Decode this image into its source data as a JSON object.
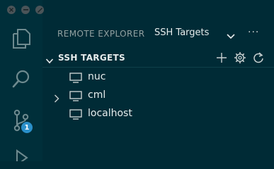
{
  "window": {
    "controls": [
      "close-icon",
      "minimize-icon",
      "fullscreen-icon"
    ]
  },
  "activity_bar": {
    "items": [
      {
        "icon": "files-icon"
      },
      {
        "icon": "search-icon"
      },
      {
        "icon": "source-control-icon",
        "badge": "1"
      },
      {
        "icon": "run-debug-icon"
      }
    ],
    "badge_color": "#2a8fc9"
  },
  "sidebar": {
    "title": "REMOTE EXPLORER",
    "selected_view": "SSH Targets",
    "more_label": "···",
    "section": {
      "title": "SSH TARGETS",
      "actions": [
        "add-icon",
        "gear-icon",
        "refresh-icon"
      ]
    },
    "targets": [
      {
        "label": "nuc",
        "expandable": false
      },
      {
        "label": "cml",
        "expandable": true
      },
      {
        "label": "localhost",
        "expandable": false
      }
    ]
  },
  "colors": {
    "background": "#002b36",
    "foreground": "#e6ecec",
    "muted": "#93a1a1"
  }
}
